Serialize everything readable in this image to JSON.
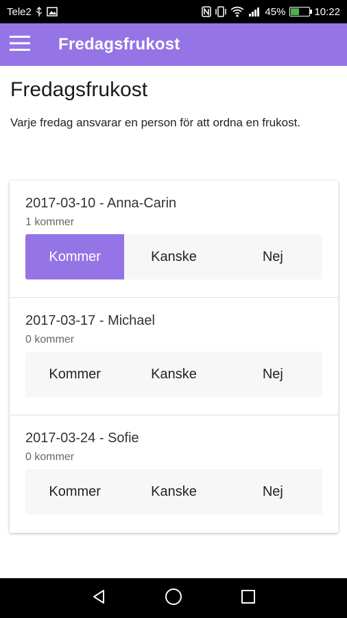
{
  "status_bar": {
    "carrier": "Tele2",
    "battery_percent": "45%",
    "battery_level": 0.45,
    "time": "10:22"
  },
  "app_bar": {
    "menu_icon": "hamburger-menu-icon",
    "title": "Fredagsfrukost"
  },
  "page": {
    "title": "Fredagsfrukost",
    "description": "Varje fredag ansvarar en person för att ordna en frukost."
  },
  "events": [
    {
      "title": "2017-03-10 - Anna-Carin",
      "count": "1 kommer",
      "options": [
        "Kommer",
        "Kanske",
        "Nej"
      ],
      "selected": "Kommer"
    },
    {
      "title": "2017-03-17 - Michael",
      "count": "0 kommer",
      "options": [
        "Kommer",
        "Kanske",
        "Nej"
      ],
      "selected": ""
    },
    {
      "title": "2017-03-24 - Sofie",
      "count": "0 kommer",
      "options": [
        "Kommer",
        "Kanske",
        "Nej"
      ],
      "selected": ""
    }
  ],
  "nav_bar": {
    "icons": [
      "back-triangle-icon",
      "home-circle-icon",
      "recents-square-icon"
    ]
  },
  "colors": {
    "accent": "#9575e6",
    "button_group_bg": "#f7f7f7"
  }
}
